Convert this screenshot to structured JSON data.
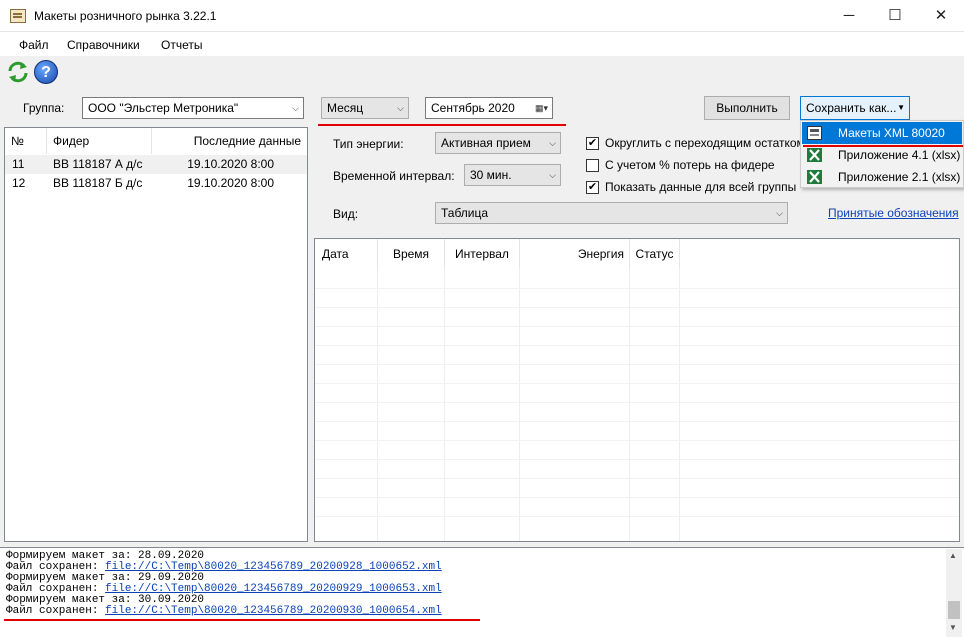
{
  "window": {
    "title": "Макеты розничного рынка 3.22.1",
    "minimize": "─",
    "maximize": "☐",
    "close": "✕"
  },
  "menu": [
    "Файл",
    "Справочники",
    "Отчеты"
  ],
  "toolbar": {
    "refresh_icon": "refresh-icon",
    "help_icon": "help-icon",
    "help_glyph": "?"
  },
  "group": {
    "label": "Группа:",
    "value": "ООО \"Эльстер Метроника\""
  },
  "period": {
    "mode": "Месяц",
    "date": "Сентябрь 2020"
  },
  "buttons": {
    "execute": "Выполнить",
    "save_as": "Сохранить как..."
  },
  "save_menu": [
    {
      "label": "Макеты XML 80020",
      "icon": "xml-icon",
      "selected": true
    },
    {
      "label": "Приложение 4.1 (xlsx)",
      "icon": "excel-icon",
      "selected": false
    },
    {
      "label": "Приложение 2.1 (xlsx)",
      "icon": "excel-icon",
      "selected": false
    }
  ],
  "energy_type": {
    "label": "Тип энергии:",
    "value": "Активная прием"
  },
  "interval": {
    "label": "Временной интервал:",
    "value": "30 мин."
  },
  "view": {
    "label": "Вид:",
    "value": "Таблица"
  },
  "options": [
    {
      "label": "Округлить с переходящим остатком",
      "checked": true
    },
    {
      "label": "С учетом % потерь на фидере",
      "checked": false
    },
    {
      "label": "Показать данные для всей группы",
      "checked": true
    }
  ],
  "legend_link": "Принятые обозначения",
  "feeders": {
    "headers": [
      "№",
      "Фидер",
      "Последние данные"
    ],
    "rows": [
      [
        "11",
        "ВВ 118187 А д/с",
        "19.10.2020 8:00"
      ],
      [
        "12",
        "ВВ 118187 Б д/с",
        "19.10.2020 8:00"
      ]
    ]
  },
  "grid": {
    "headers": [
      "Дата",
      "Время",
      "Интервал",
      "Энергия",
      "Статус"
    ]
  },
  "log": [
    {
      "prefix": "Формируем макет за: 28.09.2020",
      "link": ""
    },
    {
      "prefix": "Файл сохранен: ",
      "link": "file://C:\\Temp\\80020_123456789_20200928_1000652.xml"
    },
    {
      "prefix": "Формируем макет за: 29.09.2020",
      "link": ""
    },
    {
      "prefix": "Файл сохранен: ",
      "link": "file://C:\\Temp\\80020_123456789_20200929_1000653.xml"
    },
    {
      "prefix": "Формируем макет за: 30.09.2020",
      "link": ""
    },
    {
      "prefix": "Файл сохранен: ",
      "link": "file://C:\\Temp\\80020_123456789_20200930_1000654.xml"
    }
  ],
  "colors": {
    "accent_red": "#e00000",
    "selection": "#0078d7",
    "link": "#0b42b8"
  }
}
